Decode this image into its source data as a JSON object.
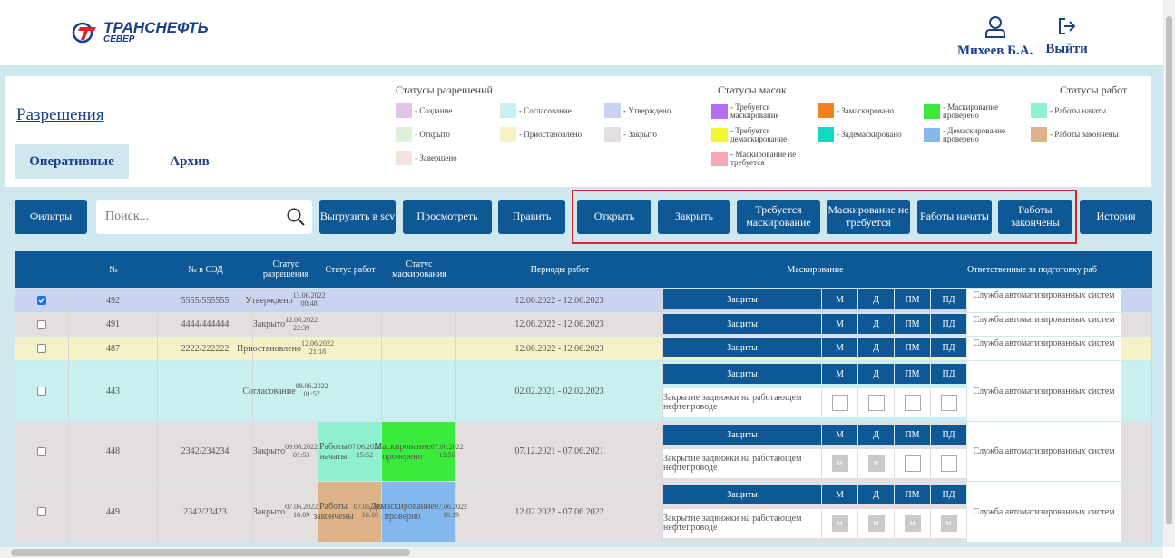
{
  "logo": {
    "line1": "ТРАНСНЕФТЬ",
    "line2": "СЕВЕР"
  },
  "user": {
    "name": "Михеев Б.А.",
    "logout": "Выйти",
    "user_icon": "user-icon",
    "logout_icon": "logout-icon"
  },
  "page": {
    "title": "Разрешения",
    "tab_active": "Оперативные",
    "tab_archive": "Архив"
  },
  "legend": {
    "permit_title": "Статусы разрешений",
    "permit": [
      {
        "label": "- Создание",
        "color": "#e3c3ea"
      },
      {
        "label": "- Согласование",
        "color": "#c8f0ef"
      },
      {
        "label": "- Утверждено",
        "color": "#cad4f1"
      },
      {
        "label": "- Открыто",
        "color": "#dff0da"
      },
      {
        "label": "- Приостановлено",
        "color": "#f6f2c8"
      },
      {
        "label": "- Закрыто",
        "color": "#e5dede"
      },
      {
        "label": "- Завершено",
        "color": "#f6e2dc"
      }
    ],
    "mask_title": "Статусы масок",
    "mask": [
      {
        "label": "- Требуется маскирование",
        "color": "#b66ef0"
      },
      {
        "label": "- Замаскировано",
        "color": "#f2801e"
      },
      {
        "label": "- Маскирование проверено",
        "color": "#3bea3b"
      },
      {
        "label": "- Требуется демаскирование",
        "color": "#f5f533"
      },
      {
        "label": "- Заде­маскировано",
        "color": "#15d6c3"
      },
      {
        "label": "- Демаскирование проверено",
        "color": "#84b8ec"
      },
      {
        "label": "- Маскирование не требуется",
        "color": "#f3a8b8"
      }
    ],
    "work_title": "Статусы работ",
    "work": [
      {
        "label": "- Работы начаты",
        "color": "#8ff0d0"
      },
      {
        "label": "- Работы закончены",
        "color": "#dcb286"
      }
    ]
  },
  "toolbar": {
    "filters": "Фильтры",
    "search_placeholder": "Поиск...",
    "export": "Выгрузить в scv",
    "view": "Просмотреть",
    "edit": "Править",
    "open": "Открыть",
    "close": "Закрыть",
    "need_mask": "Требуется маскирование",
    "no_mask": "Маскирование не требуется",
    "work_started": "Работы начаты",
    "work_finished": "Работы закончены",
    "history": "История"
  },
  "table": {
    "headers": {
      "num": "№",
      "sed": "№ в СЭД",
      "permit_status": "Статус разрешения",
      "work_status": "Статус работ",
      "mask_status": "Статус маскирования",
      "periods": "Периоды работ",
      "masking": "Маскирование",
      "responsible": "Ответственные за подготовку раб"
    },
    "mask_cols": [
      "М",
      "Д",
      "ПМ",
      "ПД"
    ],
    "protections": "Защиты",
    "valve": "Закрытие задвижки на работающем нефтепроводе",
    "responsible": "Служба автоматизированных систем",
    "rows": [
      {
        "num": "492",
        "sed": "5555/555555",
        "status": "Утверждено",
        "status_date": "13.06.2022 00:48",
        "period": "12.06.2022 - 12.06.2023"
      },
      {
        "num": "491",
        "sed": "4444/444444",
        "status": "Закрыто",
        "status_date": "12.06.2022 22:39",
        "period": "12.06.2022 - 12.06.2023"
      },
      {
        "num": "487",
        "sed": "2222/222222",
        "status": "Приостановлено",
        "status_date": "12.06.2022 21:18",
        "period": "12.06.2022 - 12.06.2023"
      },
      {
        "num": "443",
        "sed": "",
        "status": "Согласование",
        "status_date": "09.06.2022 01:57",
        "period": "02.02.2021 - 02.02.2023"
      },
      {
        "num": "448",
        "sed": "2342/234234",
        "status": "Закрыто",
        "status_date": "09.06.2022 01:53",
        "work": "Работы начаты",
        "work_date": "07.06.2022 15:52",
        "mask": "Маскирование проверено",
        "mask_date": "07.06.2022 15:50",
        "period": "07.12.2021 - 07.06.2021"
      },
      {
        "num": "449",
        "sed": "2342/23423",
        "status": "Закрыто",
        "status_date": "07.06.2022 16:09",
        "work": "Работы закончены",
        "work_date": "07.06.2022 16:10",
        "mask": "Демаскирование проверно",
        "mask_date": "07.06.2022 16:19",
        "period": "12.02.2022 - 07.06.2022"
      }
    ]
  }
}
